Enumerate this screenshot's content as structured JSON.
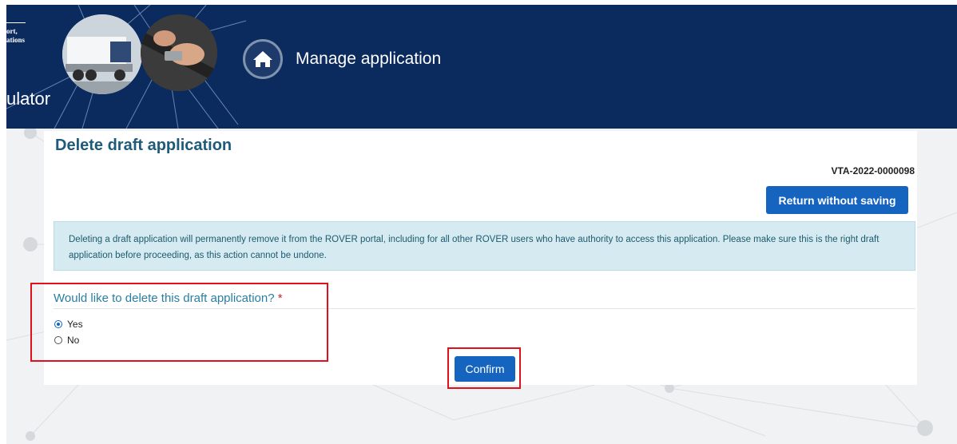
{
  "header": {
    "org_text": "ort,\nations",
    "org_suffix": "ulator",
    "title": "Manage application",
    "home_icon": "home-icon"
  },
  "page": {
    "title": "Delete draft application",
    "reference": "VTA-2022-0000098",
    "return_button": "Return without saving",
    "notice": "Deleting a draft application will permanently remove it from the ROVER portal, including for all other ROVER users who have authority to access this application. Please make sure this is the right draft application before proceeding, as this action cannot be undone."
  },
  "form": {
    "question": "Would like to delete this draft application?",
    "required_marker": "*",
    "options": [
      {
        "label": "Yes",
        "selected": true
      },
      {
        "label": "No",
        "selected": false
      }
    ],
    "confirm_button": "Confirm"
  },
  "colors": {
    "header_bg": "#0b2a5e",
    "primary_button": "#1565c0",
    "title": "#1e5a7b",
    "notice_bg": "#d5ebf1",
    "highlight": "#e0111a"
  }
}
